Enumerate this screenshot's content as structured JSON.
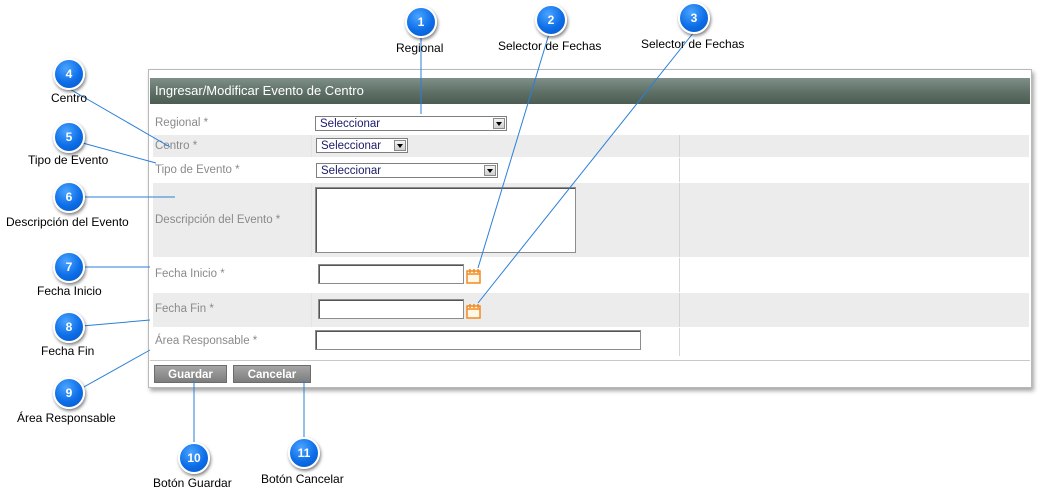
{
  "form": {
    "title": "Ingresar/Modificar Evento de Centro",
    "fields": {
      "regional": {
        "label": "Regional *",
        "value": "Seleccionar"
      },
      "centro": {
        "label": "Centro *",
        "value": "Seleccionar"
      },
      "tipo_evento": {
        "label": "Tipo de Evento *",
        "value": "Seleccionar"
      },
      "descripcion": {
        "label": "Descripción del Evento *",
        "value": ""
      },
      "fecha_inicio": {
        "label": "Fecha Inicio *",
        "value": ""
      },
      "fecha_fin": {
        "label": "Fecha Fin *",
        "value": ""
      },
      "area_responsable": {
        "label": "Área Responsable *",
        "value": ""
      }
    },
    "buttons": {
      "save": "Guardar",
      "cancel": "Cancelar"
    }
  },
  "callouts": [
    {
      "number": "1",
      "caption": "Regional"
    },
    {
      "number": "2",
      "caption": "Selector de Fechas"
    },
    {
      "number": "3",
      "caption": "Selector de Fechas"
    },
    {
      "number": "4",
      "caption": "Centro"
    },
    {
      "number": "5",
      "caption": "Tipo de Evento"
    },
    {
      "number": "6",
      "caption": "Descripción del Evento"
    },
    {
      "number": "7",
      "caption": "Fecha Inicio"
    },
    {
      "number": "8",
      "caption": "Fecha Fin"
    },
    {
      "number": "9",
      "caption": "Área Responsable"
    },
    {
      "number": "10",
      "caption": "Botón Guardar"
    },
    {
      "number": "11",
      "caption": "Botón Cancelar"
    }
  ],
  "colors": {
    "callout": "#0d6ee8",
    "header": "#5e7066",
    "button": "#8e8e8e",
    "calendar_icon": "#f08a24"
  },
  "icons": {
    "date_picker": "calendar-icon"
  }
}
